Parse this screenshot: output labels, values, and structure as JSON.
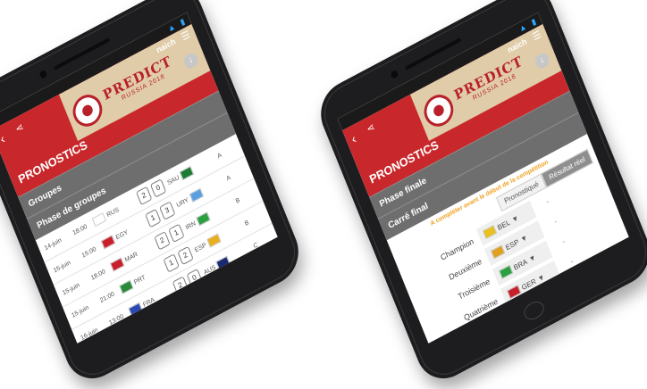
{
  "app": {
    "logo_title": "PREDICT",
    "logo_subtitle": "RUSSIA 2018",
    "page_title": "PRONOSTICS",
    "user": "naich"
  },
  "left_screen": {
    "section_groups": "Groupes",
    "section_phase": "Phase de groupes",
    "matches": [
      {
        "date": "14-juin",
        "time": "18:00",
        "team1": "RUS",
        "score1": "2",
        "score2": "0",
        "team2": "SAU",
        "group": "A",
        "flag1": "#ffffff",
        "flag2": "#1e7b34"
      },
      {
        "date": "15-juin",
        "time": "15:00",
        "team1": "EGY",
        "score1": "1",
        "score2": "3",
        "team2": "URY",
        "group": "A",
        "flag1": "#c8202a",
        "flag2": "#5aa0e0"
      },
      {
        "date": "15-juin",
        "time": "18:00",
        "team1": "MAR",
        "score1": "2",
        "score2": "1",
        "team2": "IRN",
        "group": "B",
        "flag1": "#c8202a",
        "flag2": "#2aa040"
      },
      {
        "date": "15-juin",
        "time": "21:00",
        "team1": "PRT",
        "score1": "1",
        "score2": "2",
        "team2": "ESP",
        "group": "B",
        "flag1": "#2a8a3a",
        "flag2": "#e8b020"
      },
      {
        "date": "16-juin",
        "time": "13:00",
        "team1": "FRA",
        "score1": "2",
        "score2": "0",
        "team2": "AUS",
        "group": "C",
        "flag1": "#2a4ab0",
        "flag2": "#1a2a70"
      }
    ]
  },
  "right_screen": {
    "section_phase": "Phase finale",
    "section_final": "Carré final",
    "helper": "A compléter avant le début de la compétition",
    "tab_pronostic": "Pronostiqué",
    "tab_reel": "Résultat réel",
    "ranking": [
      {
        "label": "Champion",
        "team": "BEL",
        "result": "-",
        "flag": "#e8c020"
      },
      {
        "label": "Deuxième",
        "team": "ESP",
        "result": "-",
        "flag": "#e0a020"
      },
      {
        "label": "Troisième",
        "team": "BRA",
        "result": "-",
        "flag": "#2aa040"
      },
      {
        "label": "Quatrième",
        "team": "GER",
        "result": "-",
        "flag": "#c8202a"
      }
    ]
  }
}
